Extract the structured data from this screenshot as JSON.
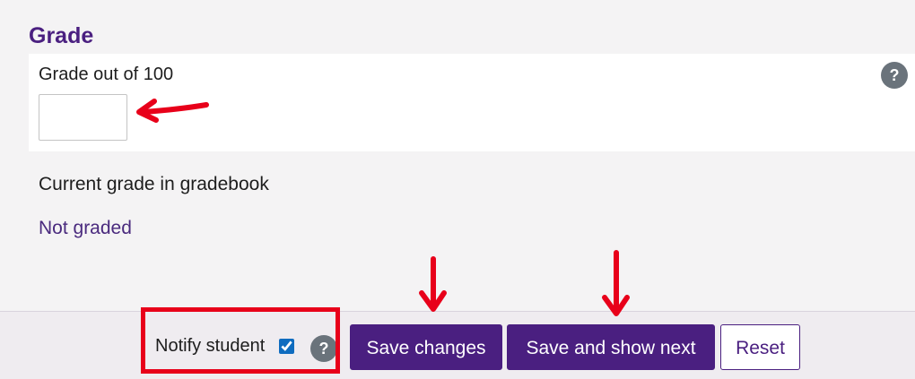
{
  "section": {
    "title": "Grade"
  },
  "grade_panel": {
    "label": "Grade out of 100",
    "input_value": "",
    "help_icon": "question-icon"
  },
  "gradebook": {
    "label": "Current grade in gradebook",
    "value": "Not graded"
  },
  "footer": {
    "notify_label": "Notify student",
    "notify_checked": true,
    "notify_help_icon": "question-icon",
    "save_label": "Save changes",
    "save_next_label": "Save and show next",
    "reset_label": "Reset"
  },
  "annotations": {
    "color": "#e8001a",
    "highlight_color": "#e8001a"
  },
  "colors": {
    "brand": "#4a1f80",
    "help_icon_bg": "#6a737b",
    "checkbox": "#0f6cbf"
  }
}
